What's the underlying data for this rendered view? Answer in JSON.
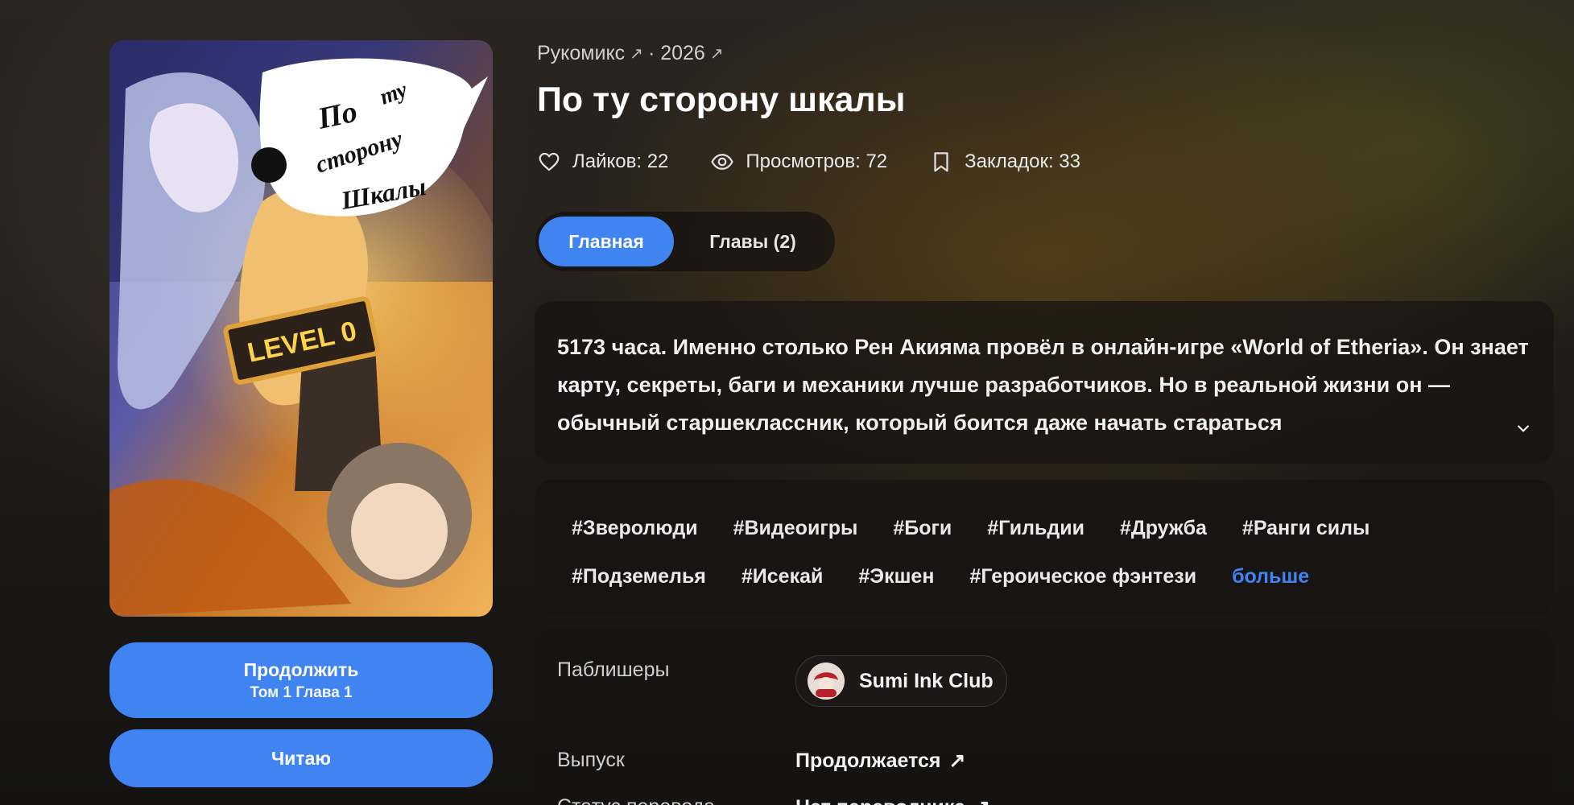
{
  "header": {
    "breadcrumbs": [
      "Рукомикс",
      "· 2026"
    ],
    "title": "По ту сторону шкалы"
  },
  "stats": {
    "likes": "Лайков: 22",
    "views": "Просмотров: 72",
    "bookmarks": "Закладок: 33"
  },
  "tabs": [
    {
      "label": "Главная",
      "active": true
    },
    {
      "label": "Главы (2)",
      "active": false
    }
  ],
  "description": "5173 часа. Именно столько Рен Акияма провёл в онлайн-игре «World of Etheria». Он знает карту, секреты, баги и механики лучше разработчиков. Но в реальной жизни он — обычный старшеклассник, который боится даже начать стараться",
  "tags": {
    "row1": [
      "#Зверолюди",
      "#Видеоигры",
      "#Боги",
      "#Гильдии",
      "#Дружба",
      "#Ранги силы"
    ],
    "row2": [
      "#Подземелья",
      "#Исекай",
      "#Экшен",
      "#Героическое фэнтези"
    ],
    "more_label": "больше"
  },
  "actions": {
    "continue_label": "Продолжить",
    "continue_sub": "Том 1 Глава 1",
    "reading_label": "Читаю"
  },
  "info": {
    "publishers_label": "Паблишеры",
    "publisher_name": "Sumi Ink Club",
    "release_label": "Выпуск",
    "release_value": "Продолжается",
    "translation_label": "Статус перевода",
    "translation_value": "Нет переводчика"
  },
  "cover": {
    "logo_lines": [
      "По",
      "ту",
      "сторону",
      "Шкалы"
    ],
    "sign_text": "LEVEL 0"
  },
  "colors": {
    "accent": "#3f84f1",
    "background": "#1a1816",
    "panel": "#161412"
  }
}
